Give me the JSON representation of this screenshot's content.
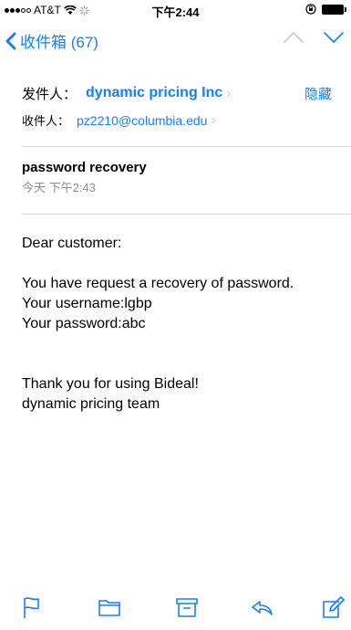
{
  "status": {
    "carrier": "AT&T",
    "time": "下午2:44"
  },
  "nav": {
    "back_label": "收件箱 (67)"
  },
  "header": {
    "from_label": "发件人：",
    "from_name": "dynamic pricing Inc",
    "hide_label": "隐藏",
    "to_label": "收件人：",
    "to_email": "pz2210@columbia.edu"
  },
  "message": {
    "subject": "password recovery",
    "date": "今天 下午2:43",
    "greeting": "Dear customer:",
    "line1": "You have request a recovery of password.",
    "line2": "Your username:lgbp",
    "line3": "Your password:abc",
    "line4": "Thank you for using Bideal!",
    "line5": "dynamic pricing team"
  },
  "colors": {
    "accent": "#157efb",
    "divider": "#d9d9d9",
    "muted": "#8e8e93"
  },
  "toolbar": [
    "flag-icon",
    "folder-icon",
    "archive-icon",
    "reply-icon",
    "compose-icon"
  ]
}
